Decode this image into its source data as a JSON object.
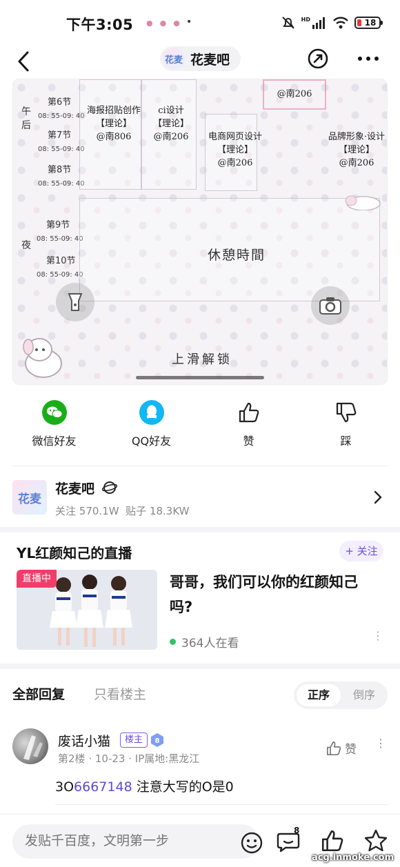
{
  "status_bar": {
    "time": "下午3:05",
    "battery": "18",
    "network": "HD"
  },
  "nav": {
    "forum_avatar_text": "花麦",
    "forum_name": "花麦吧"
  },
  "post_image": {
    "sections": [
      "午",
      "后",
      "夜"
    ],
    "periods": [
      {
        "label": "第6节",
        "time": "08: 55-09: 40"
      },
      {
        "label": "第7节",
        "time": "08: 55-09: 40"
      },
      {
        "label": "第8节",
        "time": "08: 55-09: 40"
      },
      {
        "label": "第9节",
        "time": "08: 55-09: 40"
      },
      {
        "label": "第10节",
        "time": "08: 55-09: 40"
      }
    ],
    "courses": [
      {
        "name": "海报招贴创作",
        "type": "【理论】",
        "room": "@南806"
      },
      {
        "name": "ci设计",
        "type": "【理论】",
        "room": "@南206"
      },
      {
        "name": "电商网页设计",
        "type": "【理论】",
        "room": "@南206"
      },
      {
        "name": "品牌形象·设计",
        "type": "【理论】",
        "room": "@南206"
      },
      {
        "name": "",
        "type": "",
        "room": "@南206"
      }
    ],
    "rest_text": "休憩時間",
    "swipe_text": "上滑解锁"
  },
  "share": [
    {
      "label": "微信好友",
      "icon": "wechat-icon",
      "color": "#1aad19"
    },
    {
      "label": "QQ好友",
      "icon": "qq-icon",
      "color": "#12b7f5"
    },
    {
      "label": "赞",
      "icon": "thumbs-up-icon"
    },
    {
      "label": "踩",
      "icon": "thumbs-down-icon"
    }
  ],
  "forum_card": {
    "avatar_text": "花麦",
    "name": "花麦吧",
    "followers_label": "关注",
    "followers": "570.1W",
    "posts_label": "贴子",
    "posts": "18.3KW"
  },
  "live": {
    "title": "YL红颜知己的直播",
    "follow_label": "+ 关注",
    "badge": "直播中",
    "description": "哥哥，我们可以你的红颜知己吗?",
    "viewers": "364人在看"
  },
  "replies_header": {
    "tab_all": "全部回复",
    "tab_op": "只看楼主",
    "order_asc": "正序",
    "order_desc": "倒序"
  },
  "reply": {
    "username": "废话小猫",
    "tag": "楼主",
    "level": "8",
    "floor": "第2楼",
    "date": "10-23",
    "ip": "IP属地:黑龙江",
    "like_label": "赞",
    "content_prefix": "3O",
    "content_link": "6667148",
    "content_suffix": " 注意大写的O是0"
  },
  "bottom_bar": {
    "input_placeholder": "发贴千百度，文明第一步",
    "comment_count": "8"
  },
  "watermark": "acg.inmoke.com",
  "colors": {
    "accent": "#6b4fe0",
    "live_red": "#f23d6b",
    "wechat_green": "#1aad19",
    "qq_blue": "#12b7f5"
  }
}
